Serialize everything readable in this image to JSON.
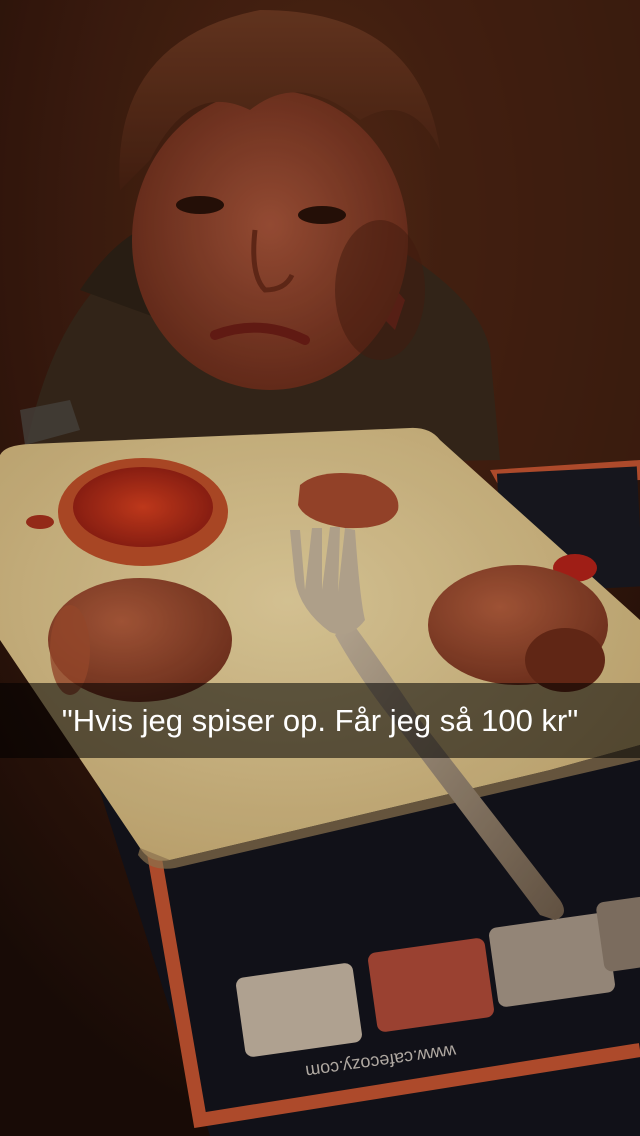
{
  "caption": {
    "text": "\"Hvis jeg spiser op. Får jeg så 100 kr\""
  },
  "placemat": {
    "url_text": "www.cafecozy.com"
  },
  "colors": {
    "background_wall": "#3a1a0e",
    "plate": "#e8cf98",
    "ketchup": "#b5231a",
    "sausage_roll": "#9a4a2e",
    "placemat_dark": "#14141c",
    "placemat_border": "#c55531",
    "caption_text": "#ffffff"
  }
}
